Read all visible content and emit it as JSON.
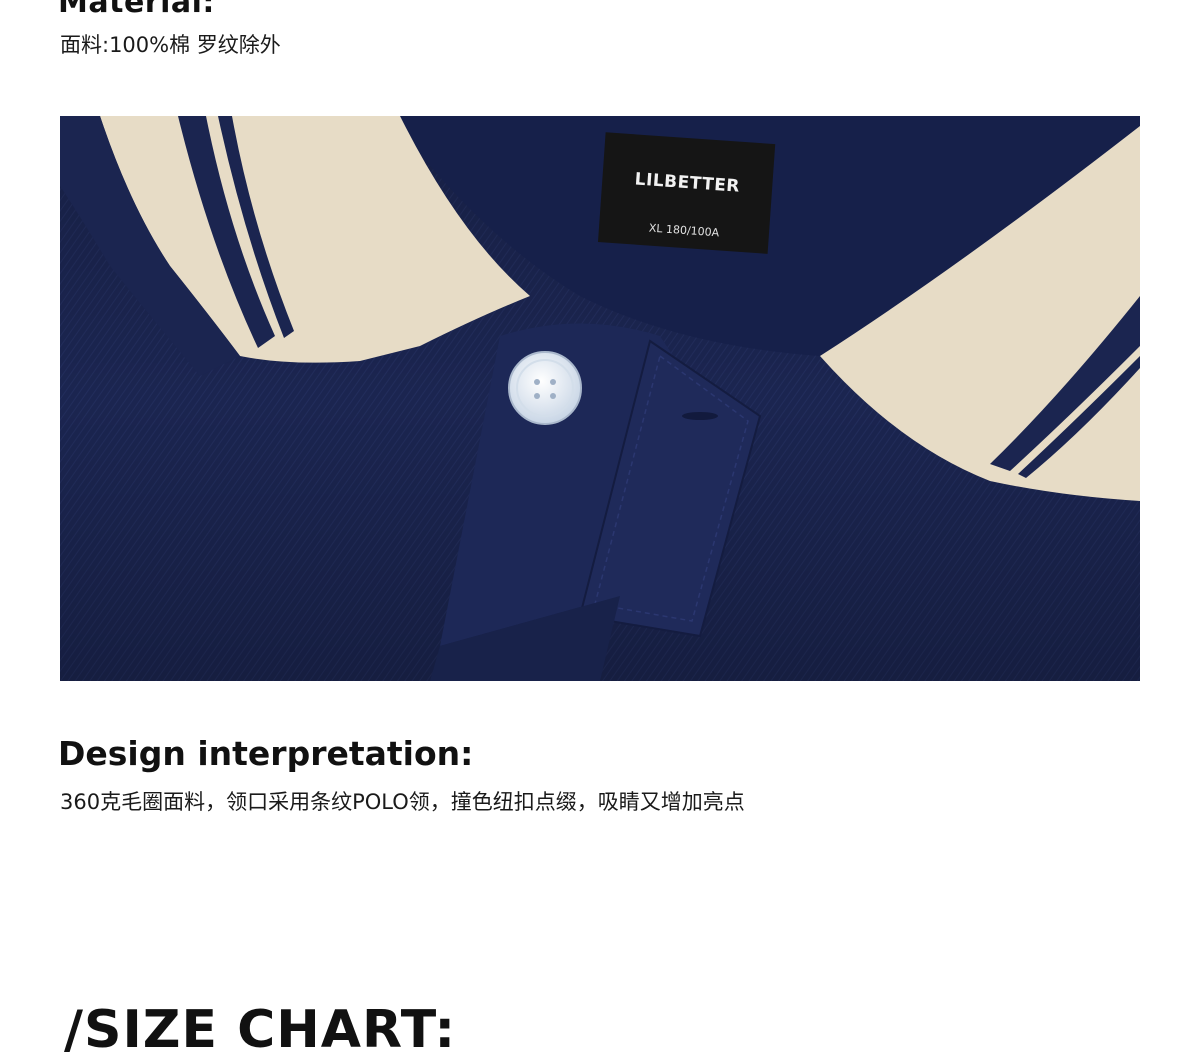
{
  "material": {
    "heading": "Material:",
    "text": "面料:100%棉 罗纹除外"
  },
  "photo": {
    "label_brand": "LILBETTER",
    "label_size": "XL 180/100A",
    "colors": {
      "navy": "#1b2550",
      "collar_cream": "#e7dcc6",
      "label_black": "#151515",
      "button_white": "#e6edf6"
    }
  },
  "design": {
    "heading": "Design interpretation:",
    "text": "360克毛圈面料，领口采用条纹POLO领，撞色纽扣点缀，吸睛又增加亮点"
  },
  "size_chart": {
    "heading": "/SIZE CHART:"
  }
}
